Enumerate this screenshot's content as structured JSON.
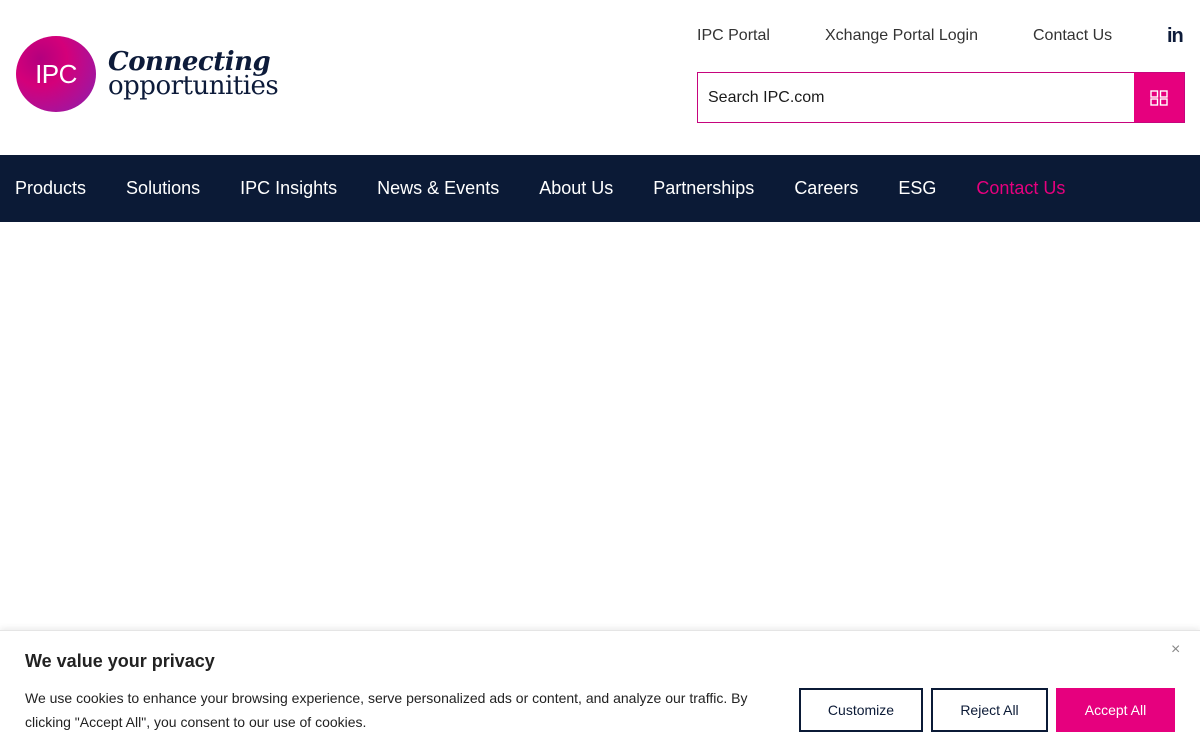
{
  "header": {
    "logo": {
      "mark_text": "IPC",
      "tagline_line1": "Connecting",
      "tagline_line2": "opportunities"
    },
    "utility_links": {
      "ipc_portal": "IPC Portal",
      "xchange": "Xchange Portal Login",
      "contact": "Contact Us"
    },
    "linkedin_glyph": "in",
    "search": {
      "placeholder": "Search IPC.com",
      "button_icon": "search-icon"
    }
  },
  "nav": {
    "items": [
      {
        "label": "Products"
      },
      {
        "label": "Solutions"
      },
      {
        "label": "IPC Insights"
      },
      {
        "label": "News & Events"
      },
      {
        "label": "About Us"
      },
      {
        "label": "Partnerships"
      },
      {
        "label": "Careers"
      },
      {
        "label": "ESG"
      },
      {
        "label": "Contact Us"
      }
    ]
  },
  "cookie_banner": {
    "title": "We value your privacy",
    "text": "We use cookies to enhance your browsing experience, serve personalized ads or content, and analyze our traffic. By clicking \"Accept All\", you consent to our use of cookies.",
    "close_glyph": "×",
    "buttons": {
      "customize": "Customize",
      "reject": "Reject All",
      "accept": "Accept All"
    }
  },
  "colors": {
    "brand_pink": "#e6007e",
    "nav_bg": "#0b1a36"
  }
}
